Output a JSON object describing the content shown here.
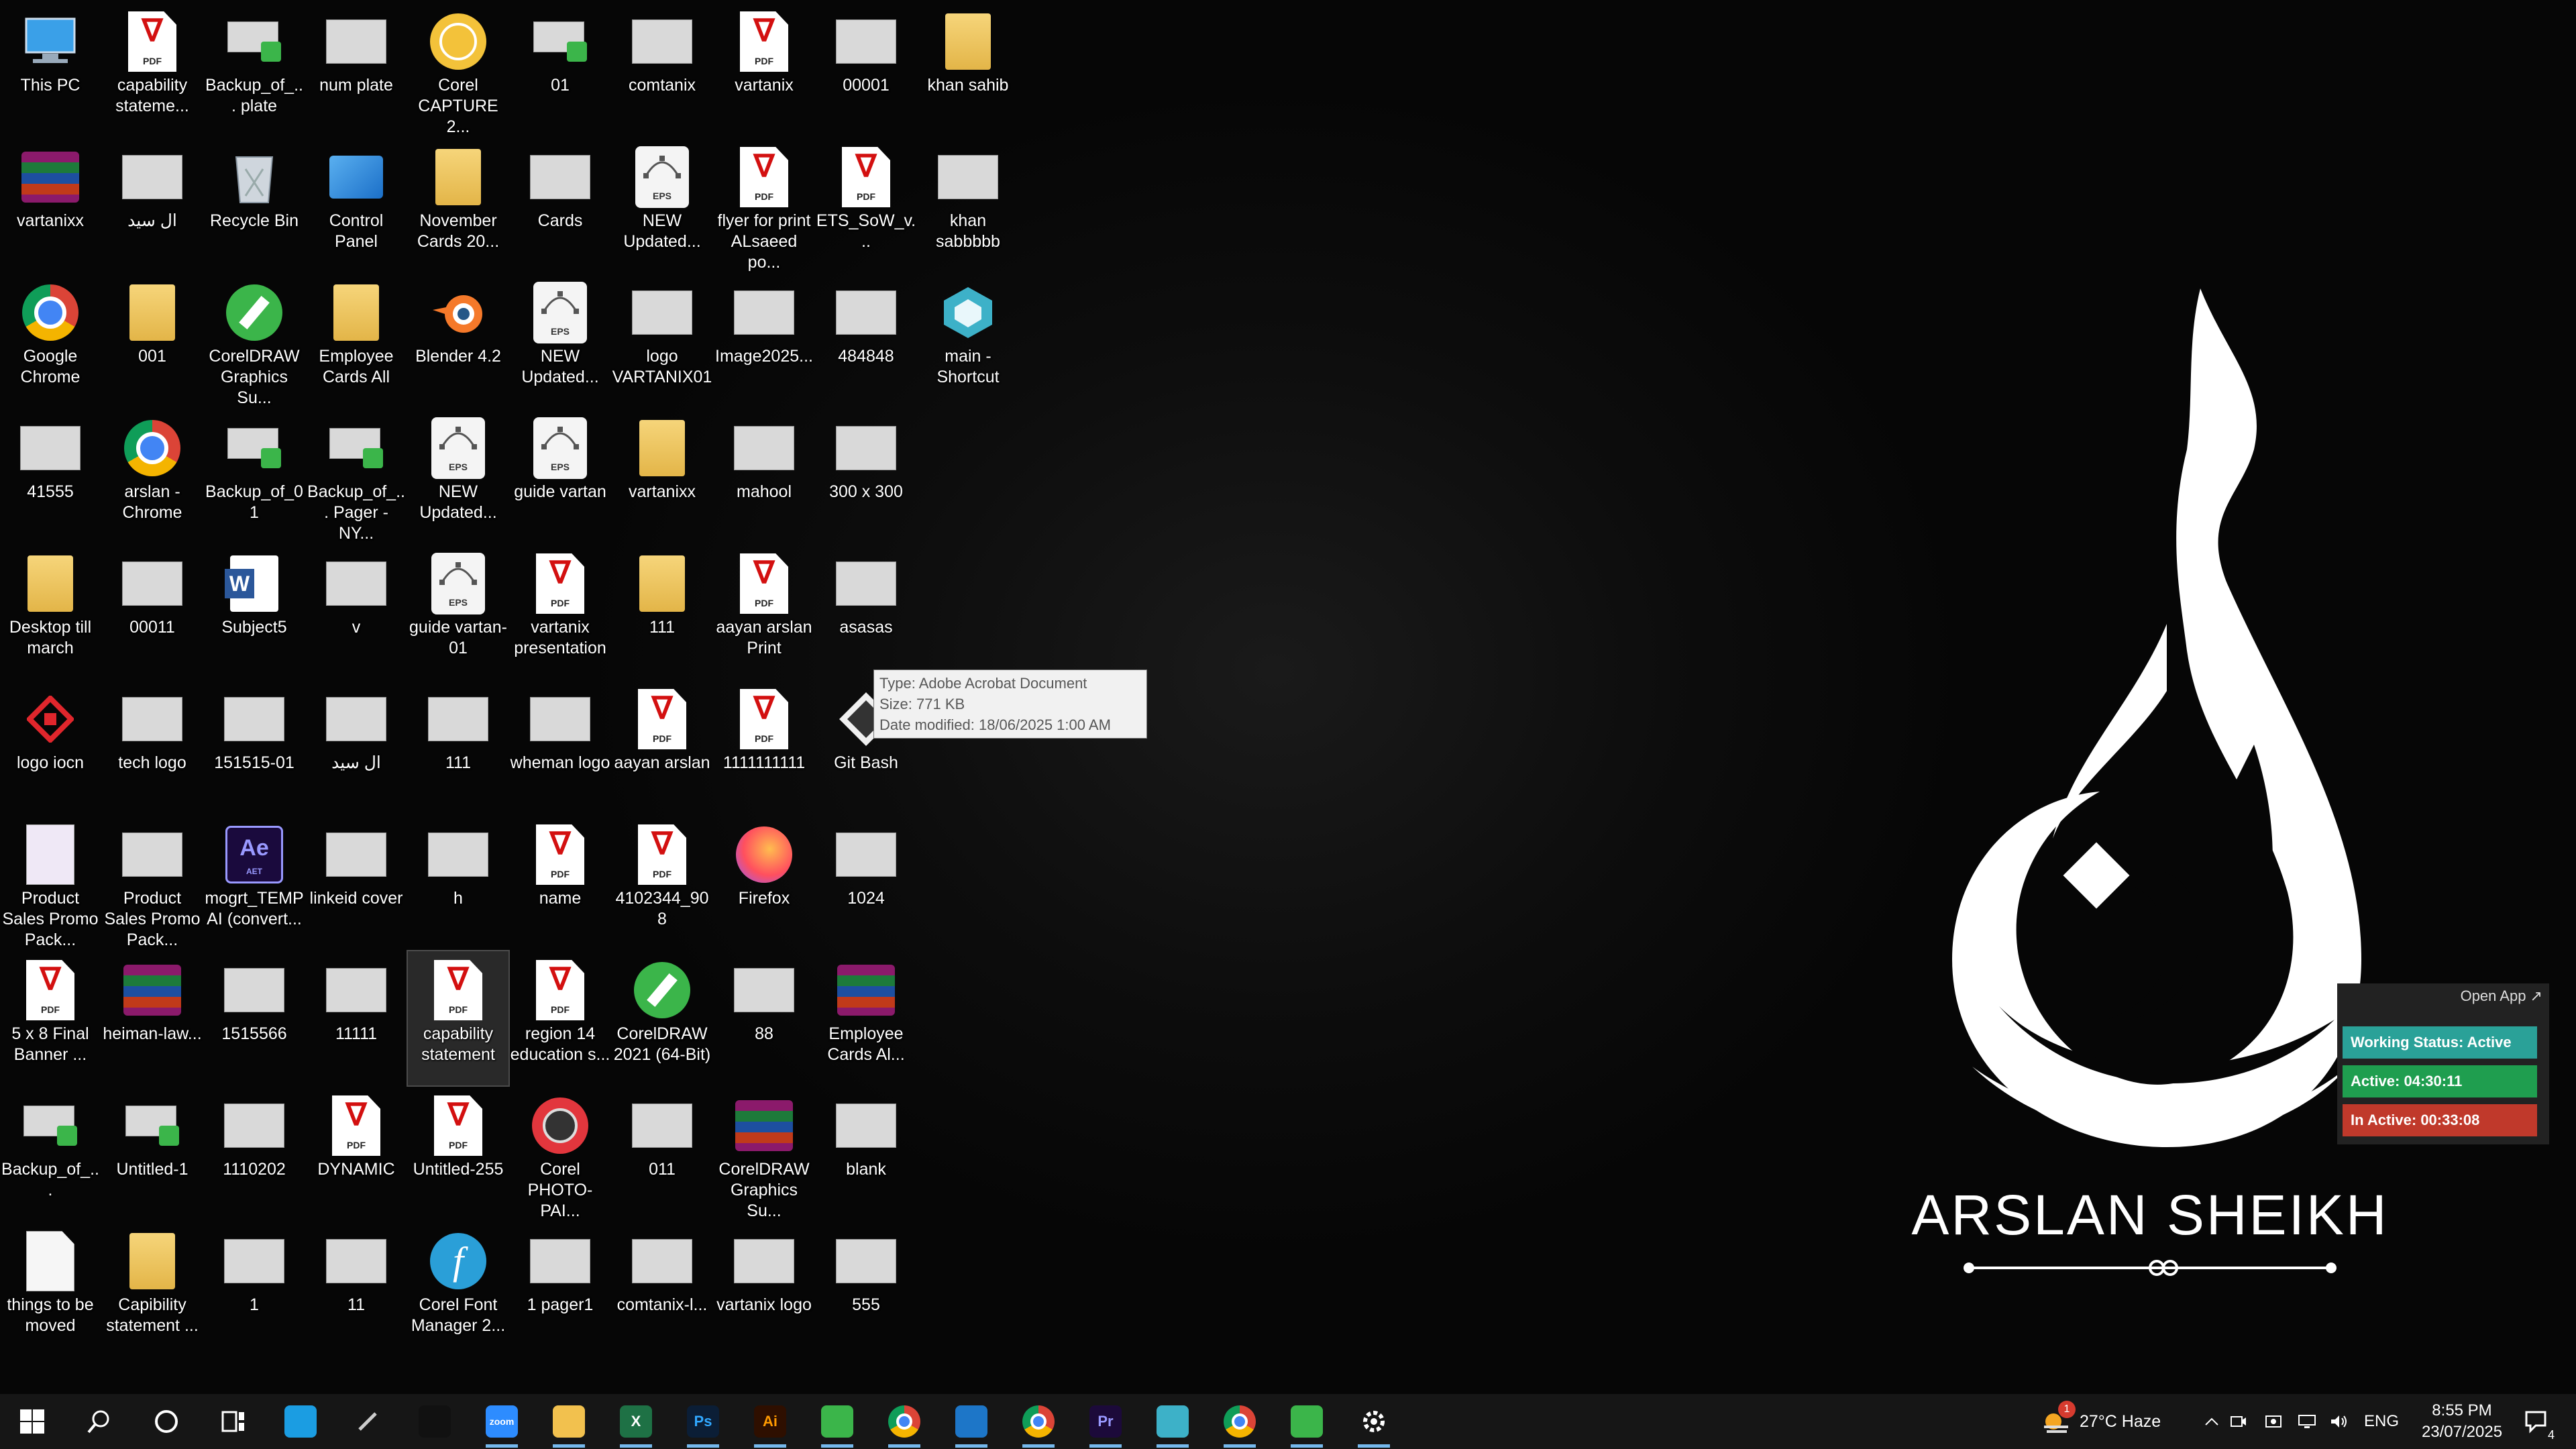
{
  "desktop_icons": [
    {
      "label": "This PC",
      "icon": "computer-icon"
    },
    {
      "label": "vartanixx",
      "icon": "winrar-icon"
    },
    {
      "label": "Google Chrome",
      "icon": "chrome-icon"
    },
    {
      "label": "41555",
      "icon": "image-thumbnail-icon"
    },
    {
      "label": "Desktop till march",
      "icon": "folder-icon"
    },
    {
      "label": "logo iocn",
      "icon": "logo-icon"
    },
    {
      "label": "Product Sales Promo Pack...",
      "icon": "document-icon"
    },
    {
      "label": "5 x 8 Final Banner ...",
      "icon": "pdf-icon"
    },
    {
      "label": "Backup_of_...",
      "icon": "coreldraw-file-icon"
    },
    {
      "label": "things to be moved",
      "icon": "blank-file-icon"
    },
    {
      "label": "capability stateme...",
      "icon": "pdf-icon"
    },
    {
      "label": "ال سيد",
      "icon": "image-thumbnail-icon"
    },
    {
      "label": "001",
      "icon": "folder-icon"
    },
    {
      "label": "arslan - Chrome",
      "icon": "chrome-profile-icon"
    },
    {
      "label": "00011",
      "icon": "image-thumbnail-icon"
    },
    {
      "label": "tech logo",
      "icon": "image-thumbnail-icon"
    },
    {
      "label": "Product Sales Promo Pack...",
      "icon": "image-thumbnail-icon"
    },
    {
      "label": "heiman-law...",
      "icon": "winrar-icon"
    },
    {
      "label": "Untitled-1",
      "icon": "coreldraw-file-icon"
    },
    {
      "label": "Capibility statement ...",
      "icon": "folder-icon"
    },
    {
      "label": "Backup_of_... plate",
      "icon": "coreldraw-file-icon"
    },
    {
      "label": "Recycle Bin",
      "icon": "recycle-bin-icon"
    },
    {
      "label": "CorelDRAW Graphics Su...",
      "icon": "coreldraw-suite-icon"
    },
    {
      "label": "Backup_of_01",
      "icon": "coreldraw-file-icon"
    },
    {
      "label": "Subject5",
      "icon": "word-icon"
    },
    {
      "label": "151515-01",
      "icon": "image-thumbnail-icon"
    },
    {
      "label": "mogrt_TEMP AI (convert...",
      "icon": "after-effects-icon"
    },
    {
      "label": "1515566",
      "icon": "image-thumbnail-icon"
    },
    {
      "label": "1110202",
      "icon": "image-thumbnail-icon"
    },
    {
      "label": "1",
      "icon": "image-thumbnail-icon"
    },
    {
      "label": "num plate",
      "icon": "image-thumbnail-icon"
    },
    {
      "label": "Control Panel",
      "icon": "control-panel-icon"
    },
    {
      "label": "Employee Cards All",
      "icon": "folder-icon"
    },
    {
      "label": "Backup_of_... Pager - NY...",
      "icon": "coreldraw-file-icon"
    },
    {
      "label": "v",
      "icon": "image-thumbnail-icon"
    },
    {
      "label": "ال سيد",
      "icon": "image-thumbnail-icon"
    },
    {
      "label": "linkeid cover",
      "icon": "image-thumbnail-icon"
    },
    {
      "label": "11111",
      "icon": "image-thumbnail-icon"
    },
    {
      "label": "DYNAMIC",
      "icon": "pdf-icon"
    },
    {
      "label": "11",
      "icon": "image-thumbnail-icon"
    },
    {
      "label": "Corel CAPTURE 2...",
      "icon": "corel-capture-icon"
    },
    {
      "label": "November Cards 20...",
      "icon": "folder-icon"
    },
    {
      "label": "Blender 4.2",
      "icon": "blender-icon"
    },
    {
      "label": "NEW Updated...",
      "icon": "eps-icon"
    },
    {
      "label": "guide vartan-01",
      "icon": "eps-icon"
    },
    {
      "label": "111",
      "icon": "image-thumbnail-icon"
    },
    {
      "label": "h",
      "icon": "image-thumbnail-icon"
    },
    {
      "label": "capability statement",
      "icon": "pdf-icon",
      "selected": true
    },
    {
      "label": "Untitled-255",
      "icon": "pdf-icon"
    },
    {
      "label": "Corel Font Manager 2...",
      "icon": "corel-font-manager-icon"
    },
    {
      "label": "01",
      "icon": "coreldraw-file-icon"
    },
    {
      "label": "Cards",
      "icon": "image-thumbnail-icon"
    },
    {
      "label": "NEW Updated...",
      "icon": "eps-icon"
    },
    {
      "label": "guide vartan",
      "icon": "eps-icon"
    },
    {
      "label": "vartanix presentation",
      "icon": "pdf-icon"
    },
    {
      "label": "wheman logo",
      "icon": "image-thumbnail-icon"
    },
    {
      "label": "name",
      "icon": "pdf-icon"
    },
    {
      "label": "region 14 education s...",
      "icon": "pdf-icon"
    },
    {
      "label": "Corel PHOTO-PAI...",
      "icon": "corel-photopaint-icon"
    },
    {
      "label": "1 pager1",
      "icon": "image-thumbnail-icon"
    },
    {
      "label": "comtanix",
      "icon": "image-thumbnail-icon"
    },
    {
      "label": "NEW Updated...",
      "icon": "eps-icon"
    },
    {
      "label": "logo VARTANIX01",
      "icon": "image-thumbnail-icon"
    },
    {
      "label": "vartanixx",
      "icon": "folder-icon"
    },
    {
      "label": "111",
      "icon": "folder-icon"
    },
    {
      "label": "aayan arslan",
      "icon": "pdf-icon"
    },
    {
      "label": "4102344_908",
      "icon": "pdf-icon"
    },
    {
      "label": "CorelDRAW 2021 (64-Bit)",
      "icon": "coreldraw-app-icon"
    },
    {
      "label": "011",
      "icon": "image-thumbnail-icon"
    },
    {
      "label": "comtanix-l...",
      "icon": "image-thumbnail-icon"
    },
    {
      "label": "vartanix",
      "icon": "pdf-icon"
    },
    {
      "label": "flyer for print ALsaeed po...",
      "icon": "pdf-icon"
    },
    {
      "label": "Image2025...",
      "icon": "image-thumbnail-icon"
    },
    {
      "label": "mahool",
      "icon": "image-thumbnail-icon"
    },
    {
      "label": "aayan arslan Print",
      "icon": "pdf-icon"
    },
    {
      "label": "1111111111",
      "icon": "pdf-icon"
    },
    {
      "label": "Firefox",
      "icon": "firefox-icon"
    },
    {
      "label": "88",
      "icon": "image-thumbnail-icon"
    },
    {
      "label": "CorelDRAW Graphics Su...",
      "icon": "winrar-icon"
    },
    {
      "label": "vartanix logo",
      "icon": "image-thumbnail-icon"
    },
    {
      "label": "00001",
      "icon": "image-thumbnail-icon"
    },
    {
      "label": "ETS_SoW_v...",
      "icon": "pdf-icon"
    },
    {
      "label": "484848",
      "icon": "image-thumbnail-icon"
    },
    {
      "label": "300 x 300",
      "icon": "image-thumbnail-icon"
    },
    {
      "label": "asasas",
      "icon": "image-thumbnail-icon"
    },
    {
      "label": "Git Bash",
      "icon": "git-bash-icon"
    },
    {
      "label": "1024",
      "icon": "image-thumbnail-icon"
    },
    {
      "label": "Employee Cards Al...",
      "icon": "winrar-icon"
    },
    {
      "label": "blank",
      "icon": "image-thumbnail-icon"
    },
    {
      "label": "555",
      "icon": "image-thumbnail-icon"
    },
    {
      "label": "khan sahib",
      "icon": "folder-icon"
    },
    {
      "label": "khan sabbbbb",
      "icon": "image-thumbnail-icon"
    },
    {
      "label": "main - Shortcut",
      "icon": "shortcut-app-icon"
    }
  ],
  "tooltip": {
    "type": "Type: Adobe Acrobat Document",
    "size": "Size: 771 KB",
    "modified": "Date modified: 18/06/2025 1:00 AM"
  },
  "wallpaper": {
    "signature": "ARSLAN SHEIKH"
  },
  "widget": {
    "open_app": "Open App ↗",
    "working_status": "Working Status: Active",
    "active": "Active: 04:30:11",
    "inactive": "In Active: 00:33:08",
    "colors": {
      "status": "#2aa198",
      "active": "#1f9e4f",
      "inactive": "#c0392b"
    }
  },
  "taskbar": {
    "apps": [
      {
        "name": "start-button",
        "icon": "windows-icon"
      },
      {
        "name": "search-button",
        "icon": "search-icon"
      },
      {
        "name": "cortana-button",
        "icon": "cortana-icon"
      },
      {
        "name": "task-view-button",
        "icon": "task-view-icon"
      },
      {
        "name": "edge",
        "icon": "edge-icon"
      },
      {
        "name": "pen",
        "icon": "pen-icon"
      },
      {
        "name": "terminal",
        "icon": "terminal-icon"
      },
      {
        "name": "zoom",
        "icon": "zoom-icon",
        "text": "zoom"
      },
      {
        "name": "file-explorer",
        "icon": "folder-icon"
      },
      {
        "name": "excel",
        "icon": "excel-icon",
        "text": "X"
      },
      {
        "name": "photoshop",
        "icon": "photoshop-icon",
        "text": "Ps"
      },
      {
        "name": "illustrator",
        "icon": "illustrator-icon",
        "text": "Ai"
      },
      {
        "name": "coreldraw",
        "icon": "coreldraw-icon"
      },
      {
        "name": "chrome",
        "icon": "chrome-icon"
      },
      {
        "name": "vscode",
        "icon": "vscode-icon"
      },
      {
        "name": "chrome-profile",
        "icon": "chrome-icon"
      },
      {
        "name": "premiere",
        "icon": "premiere-icon",
        "text": "Pr"
      },
      {
        "name": "app-shortcut",
        "icon": "app-icon"
      },
      {
        "name": "chrome-2",
        "icon": "chrome-icon"
      },
      {
        "name": "coreldraw-2",
        "icon": "coreldraw-icon"
      },
      {
        "name": "settings",
        "icon": "gear-icon"
      }
    ],
    "weather": "27°C  Haze",
    "weather_badge": "1",
    "language": "ENG",
    "time": "8:55 PM",
    "date": "23/07/2025",
    "notifications_count": "4"
  }
}
